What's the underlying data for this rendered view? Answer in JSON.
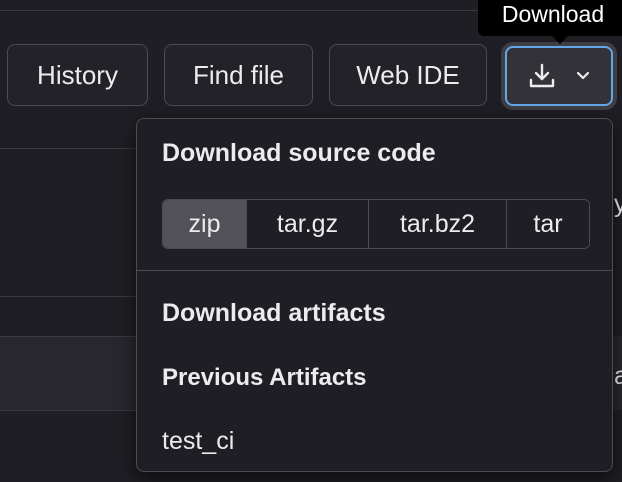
{
  "toolbar": {
    "history_label": "History",
    "find_file_label": "Find file",
    "web_ide_label": "Web IDE",
    "download_icon": "download-icon",
    "chevron_icon": "chevron-down-icon"
  },
  "tooltip": {
    "text": "Download"
  },
  "dropdown": {
    "source_heading": "Download source code",
    "formats": [
      {
        "label": "zip",
        "selected": true
      },
      {
        "label": "tar.gz",
        "selected": false
      },
      {
        "label": "tar.bz2",
        "selected": false
      },
      {
        "label": "tar",
        "selected": false
      }
    ],
    "artifacts_heading": "Download artifacts",
    "previous_artifacts_heading": "Previous Artifacts",
    "artifacts": [
      "test_ci"
    ]
  },
  "background": {
    "edge_chars": [
      "y",
      "a"
    ]
  },
  "colors": {
    "page_bg": "#1f1e24",
    "focus_ring": "#63a6e9",
    "selected_segment": "#535158",
    "border": "#4c4b51"
  }
}
